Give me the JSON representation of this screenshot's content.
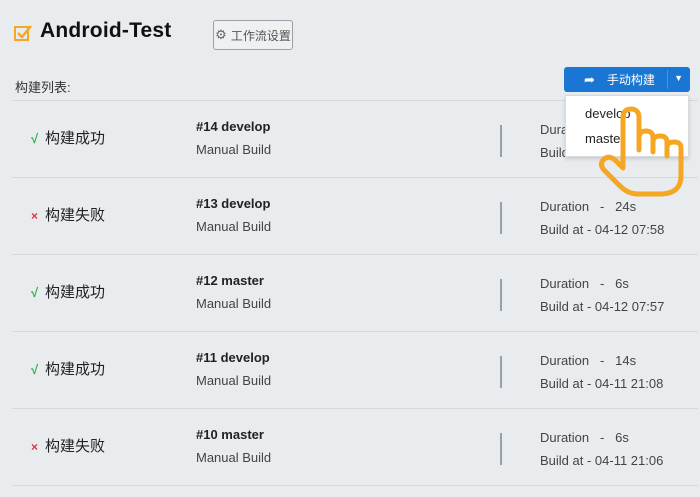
{
  "header": {
    "title": "Android-Test",
    "settings_label": "工作流设置"
  },
  "list_label": "构建列表:",
  "build_button": {
    "label": "手动构建"
  },
  "dropdown": {
    "options": [
      "develop",
      "master"
    ]
  },
  "colors": {
    "accent": "#1976d2",
    "success": "#2bb04a",
    "failure": "#dc3545",
    "title_icon": "#f5a623"
  },
  "builds": [
    {
      "status": "构建成功",
      "ok": true,
      "mark": "√",
      "number": "#14 develop",
      "type": "Manual Build",
      "duration": "Duration",
      "build_at": "Build"
    },
    {
      "status": "构建失败",
      "ok": false,
      "mark": "×",
      "number": "#13 develop",
      "type": "Manual Build",
      "duration": "Duration   -   24s",
      "build_at": "Build at - 04-12 07:58"
    },
    {
      "status": "构建成功",
      "ok": true,
      "mark": "√",
      "number": "#12 master",
      "type": "Manual Build",
      "duration": "Duration   -   6s",
      "build_at": "Build at - 04-12 07:57"
    },
    {
      "status": "构建成功",
      "ok": true,
      "mark": "√",
      "number": "#11 develop",
      "type": "Manual Build",
      "duration": "Duration   -   14s",
      "build_at": "Build at - 04-11 21:08"
    },
    {
      "status": "构建失败",
      "ok": false,
      "mark": "×",
      "number": "#10 master",
      "type": "Manual Build",
      "duration": "Duration   -   6s",
      "build_at": "Build at - 04-11 21:06"
    }
  ]
}
